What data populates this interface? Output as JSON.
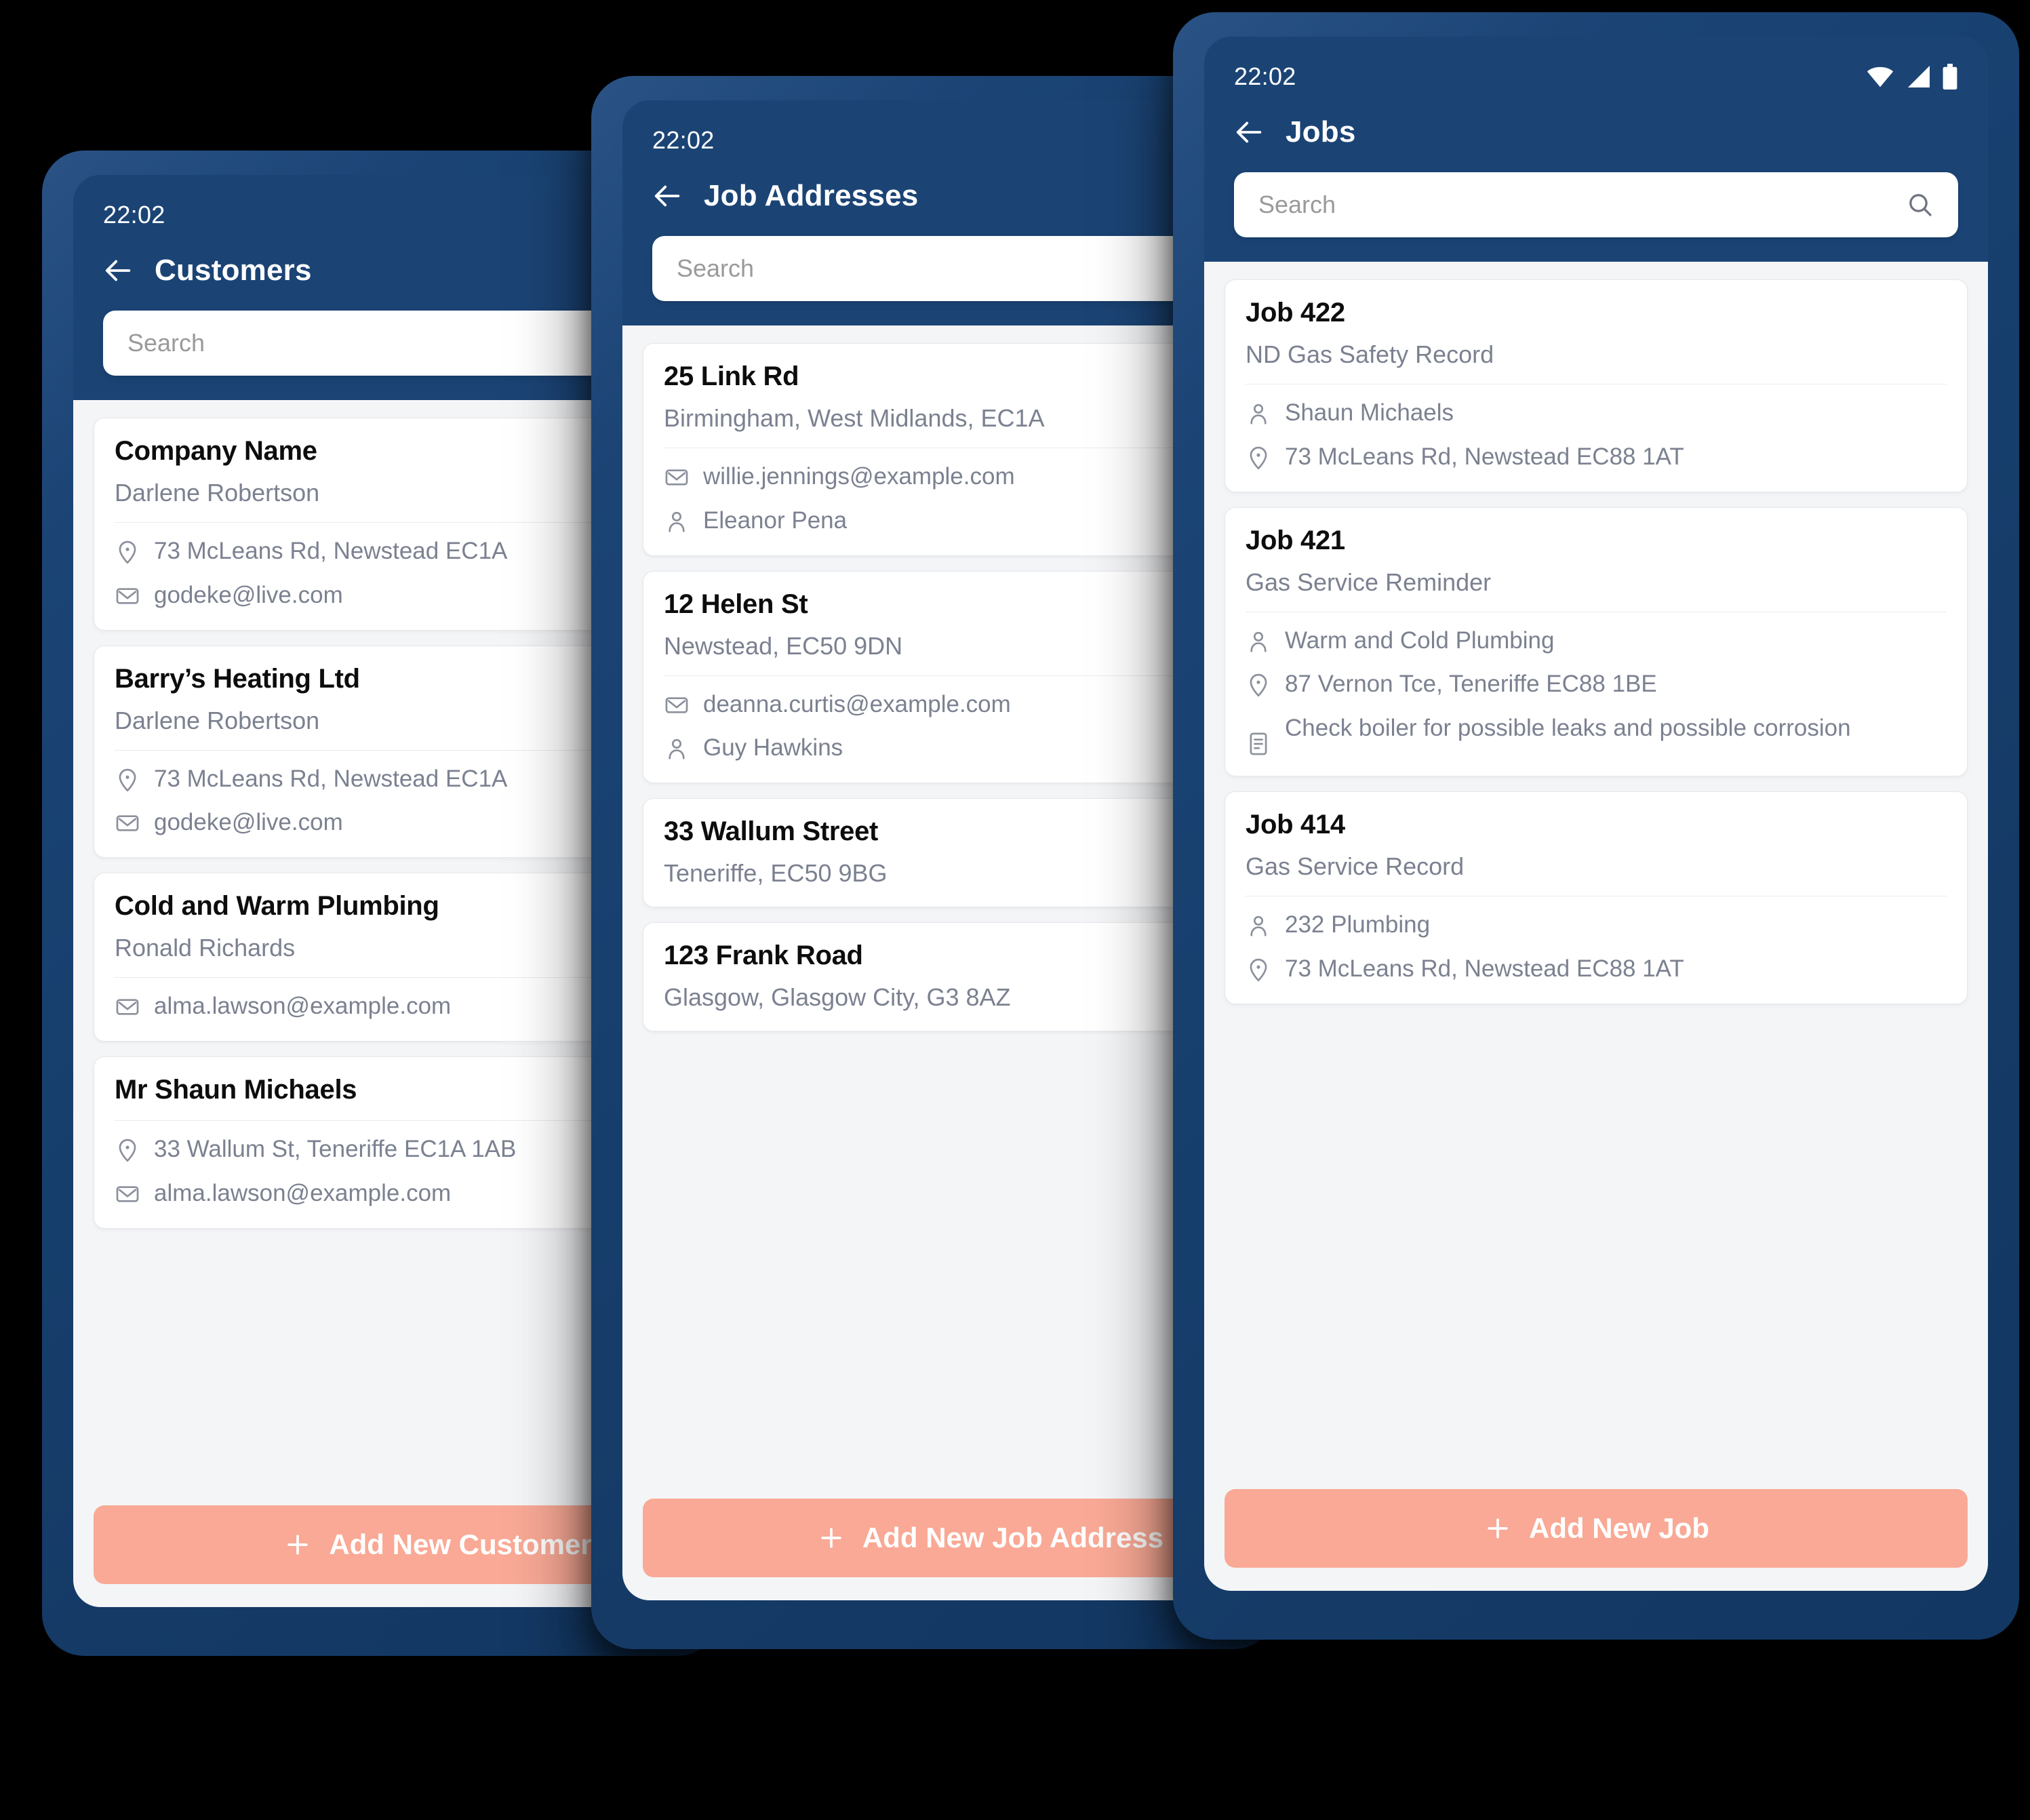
{
  "theme": {
    "bezel_blue": "#1b4475",
    "header_blue": "#1b4475",
    "content_bg": "#f4f5f7",
    "card_bg": "#ffffff",
    "accent_salmon": "#f9a995",
    "muted_text": "#7b8190",
    "title_text": "#0d0d0d"
  },
  "screens": {
    "customers": {
      "status": {
        "clock": "22:02"
      },
      "title": "Customers",
      "search": {
        "placeholder": "Search",
        "value": ""
      },
      "cta": {
        "label": "Add New Customer",
        "icon": "plus-icon"
      },
      "cards": [
        {
          "title": "Company Name",
          "subtitle": "Darlene Robertson",
          "rows": [
            {
              "icon": "location-pin-icon",
              "text": "73 McLeans Rd, Newstead EC1A"
            },
            {
              "icon": "mail-icon",
              "text": "godeke@live.com"
            }
          ]
        },
        {
          "title": "Barry’s Heating Ltd",
          "subtitle": "Darlene Robertson",
          "rows": [
            {
              "icon": "location-pin-icon",
              "text": "73 McLeans Rd, Newstead EC1A"
            },
            {
              "icon": "mail-icon",
              "text": "godeke@live.com"
            }
          ]
        },
        {
          "title": "Cold and Warm Plumbing",
          "subtitle": "Ronald Richards",
          "rows": [
            {
              "icon": "mail-icon",
              "text": "alma.lawson@example.com"
            }
          ]
        },
        {
          "title": "Mr Shaun Michaels",
          "subtitle": "",
          "rows": [
            {
              "icon": "location-pin-icon",
              "text": "33 Wallum St, Teneriffe EC1A 1AB"
            },
            {
              "icon": "mail-icon",
              "text": "alma.lawson@example.com"
            }
          ]
        }
      ]
    },
    "job_addresses": {
      "status": {
        "clock": "22:02"
      },
      "title": "Job Addresses",
      "search": {
        "placeholder": "Search",
        "value": ""
      },
      "cta": {
        "label": "Add New Job Address",
        "icon": "plus-icon"
      },
      "cards": [
        {
          "title": "25 Link Rd",
          "subtitle": "Birmingham, West Midlands, EC1A",
          "rows": [
            {
              "icon": "mail-icon",
              "text": "willie.jennings@example.com"
            },
            {
              "icon": "person-icon",
              "text": "Eleanor Pena"
            }
          ]
        },
        {
          "title": "12 Helen St",
          "subtitle": "Newstead, EC50 9DN",
          "rows": [
            {
              "icon": "mail-icon",
              "text": "deanna.curtis@example.com"
            },
            {
              "icon": "person-icon",
              "text": "Guy Hawkins"
            }
          ]
        },
        {
          "title": "33 Wallum Street",
          "subtitle": "Teneriffe, EC50 9BG",
          "rows": []
        },
        {
          "title": "123 Frank Road",
          "subtitle": "Glasgow, Glasgow City, G3 8AZ",
          "rows": []
        }
      ]
    },
    "jobs": {
      "status": {
        "clock": "22:02",
        "icons": [
          "wifi-icon",
          "cell-signal-icon",
          "battery-icon"
        ]
      },
      "title": "Jobs",
      "search": {
        "placeholder": "Search",
        "value": ""
      },
      "cta": {
        "label": "Add New Job",
        "icon": "plus-icon"
      },
      "cards": [
        {
          "title": "Job 422",
          "subtitle": "ND Gas Safety Record",
          "rows": [
            {
              "icon": "person-icon",
              "text": "Shaun Michaels"
            },
            {
              "icon": "location-pin-icon",
              "text": "73 McLeans Rd, Newstead EC88 1AT"
            }
          ]
        },
        {
          "title": "Job 421",
          "subtitle": "Gas Service Reminder",
          "rows": [
            {
              "icon": "person-icon",
              "text": "Warm and Cold Plumbing"
            },
            {
              "icon": "location-pin-icon",
              "text": "87 Vernon Tce, Teneriffe EC88 1BE"
            },
            {
              "icon": "note-icon",
              "text": "Check boiler for possible leaks and possible corrosion"
            }
          ]
        },
        {
          "title": "Job 414",
          "subtitle": "Gas Service Record",
          "rows": [
            {
              "icon": "person-icon",
              "text": "232 Plumbing"
            },
            {
              "icon": "location-pin-icon",
              "text": "73 McLeans Rd, Newstead EC88 1AT"
            }
          ]
        }
      ]
    }
  }
}
